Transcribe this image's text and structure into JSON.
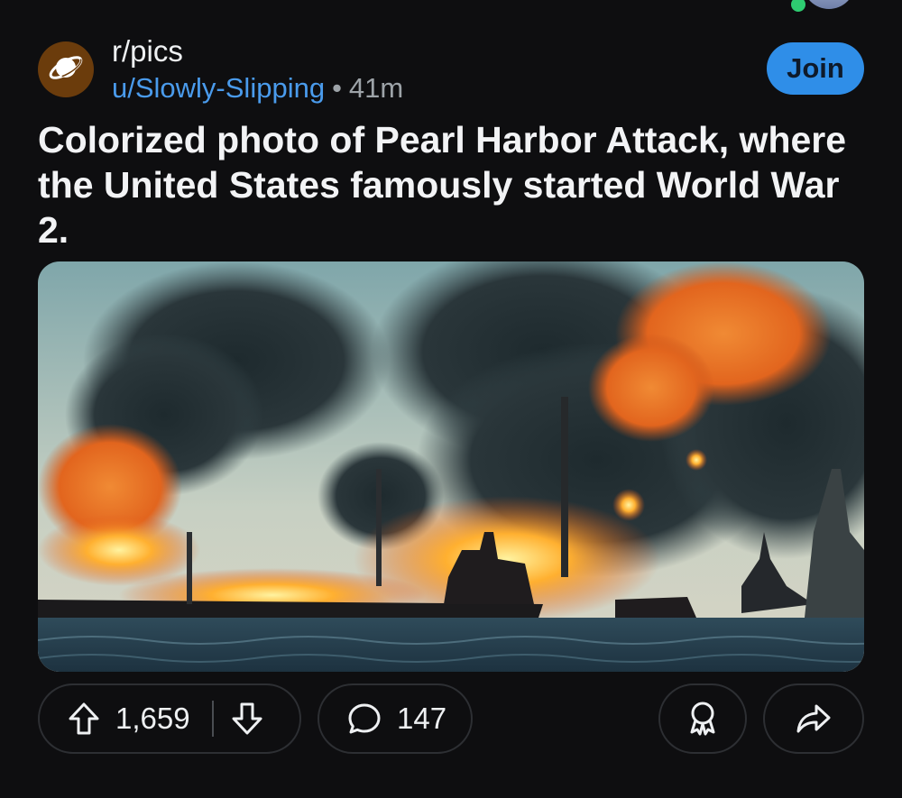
{
  "post": {
    "subreddit": "r/pics",
    "username": "u/Slowly-Slipping",
    "separator": "•",
    "time_ago": "41m",
    "join_label": "Join",
    "title": "Colorized photo of Pearl Harbor Attack, where the United States famously started World War 2."
  },
  "actions": {
    "upvotes": "1,659",
    "comments": "147"
  },
  "icons": {
    "subreddit": "planet-icon",
    "upvote": "arrow-up-icon",
    "downvote": "arrow-down-icon",
    "comment": "speech-bubble-icon",
    "award": "award-icon",
    "share": "share-arrow-icon"
  },
  "colors": {
    "background": "#0e0e10",
    "accent_blue": "#2f8ee8",
    "username_blue": "#4a9bec",
    "subreddit_icon_bg": "#6b3c0c"
  }
}
